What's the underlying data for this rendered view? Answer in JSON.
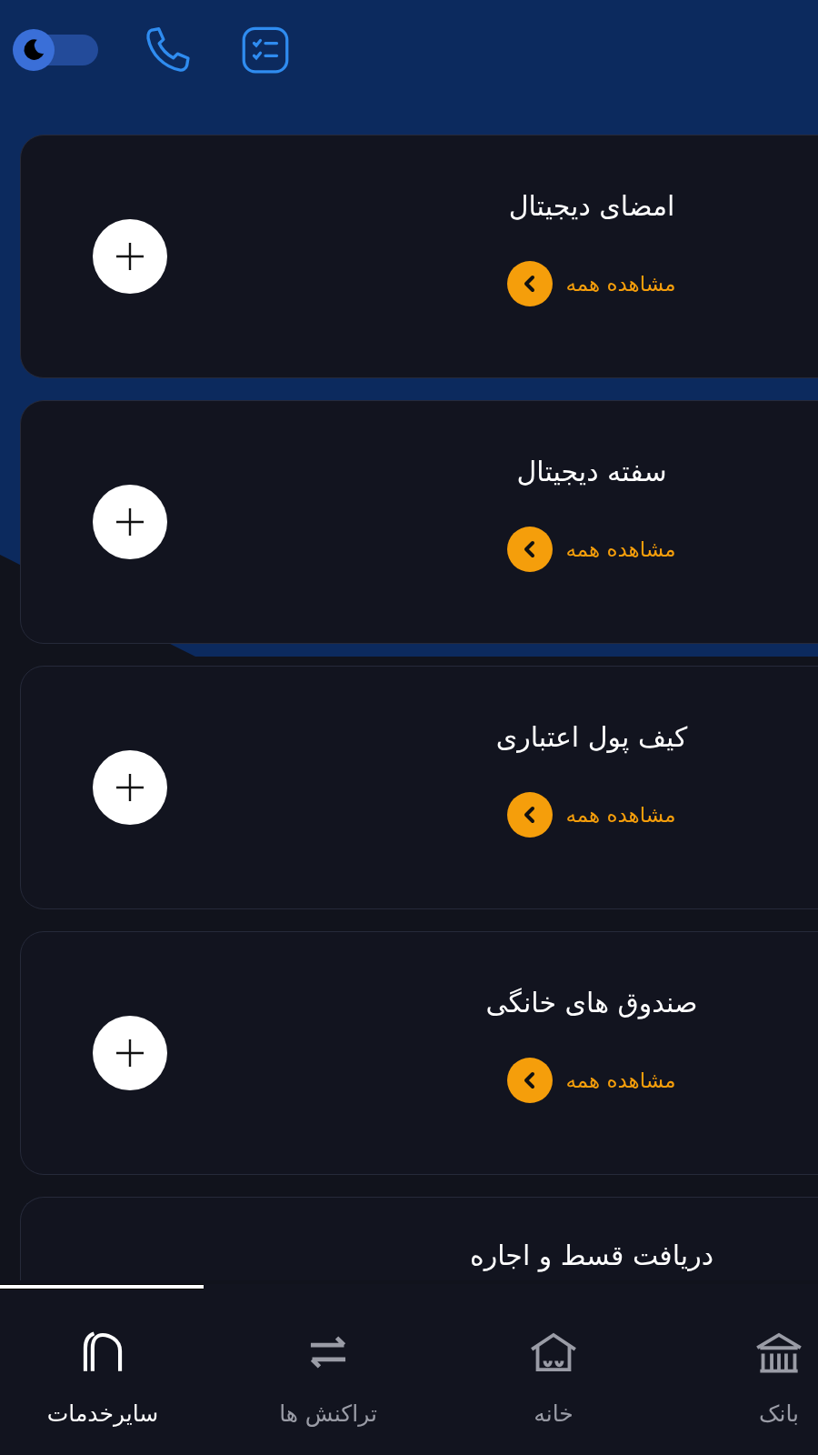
{
  "header": {
    "dark_mode_toggle": {
      "on": true
    }
  },
  "cards": [
    {
      "title": "امضای دیجیتال",
      "link": "مشاهده همه"
    },
    {
      "title": "سفته دیجیتال",
      "link": "مشاهده همه"
    },
    {
      "title": "کیف پول اعتباری",
      "link": "مشاهده همه"
    },
    {
      "title": "صندوق های خانگی",
      "link": "مشاهده همه"
    },
    {
      "title": "دریافت قسط و اجاره"
    }
  ],
  "bottom_nav": [
    {
      "label": "بانک",
      "selected": false,
      "kind": "bank"
    },
    {
      "label": "خانه",
      "selected": false,
      "kind": "home"
    },
    {
      "label": "تراکنش ها",
      "selected": false,
      "kind": "transfer"
    },
    {
      "label": "سایرخدمات",
      "selected": true,
      "kind": "services"
    }
  ]
}
